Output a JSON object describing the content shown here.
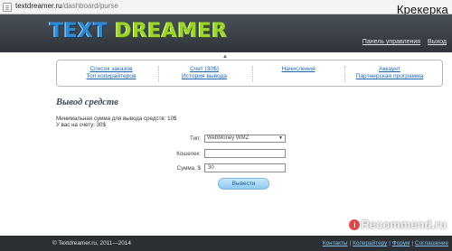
{
  "browser": {
    "url_host": "textdreamer.ru",
    "url_path": "/dashboard/purse",
    "watermark": "Крекерка"
  },
  "header": {
    "logo_word1": "TEXT",
    "logo_word2": "DREAMER",
    "link_panel": "Панель управления",
    "link_logout": "Выход"
  },
  "nav": {
    "items": [
      {
        "label": "Список заказов"
      },
      {
        "label": "Топ копирайтеров"
      },
      {
        "label": "Счет (30$)"
      },
      {
        "label": "История вывода"
      },
      {
        "label": "Начисления"
      },
      {
        "label": "Аккаунт"
      },
      {
        "label": "Партнерская программа"
      }
    ]
  },
  "main": {
    "title": "Вывод средств",
    "min_withdraw": "Минимальная сумма для вывода средств: 10$",
    "balance": "У вас на счету: 30$",
    "form": {
      "type_label": "Тип:",
      "type_value": "WebMoney WMZ",
      "wallet_label": "Кошелек:",
      "wallet_value": "",
      "amount_label": "Сумма, $",
      "amount_value": "30",
      "submit_label": "Вывести"
    }
  },
  "footer": {
    "copyright": "© Textdreamer.ru, 2011—2014",
    "links": [
      {
        "label": "Контакты"
      },
      {
        "label": "Копирайтеру"
      },
      {
        "label": "Форум"
      },
      {
        "label": "Соглашение"
      }
    ]
  },
  "overlay": {
    "recommend_mark": "i",
    "recommend_text": "Recommend.ru"
  }
}
